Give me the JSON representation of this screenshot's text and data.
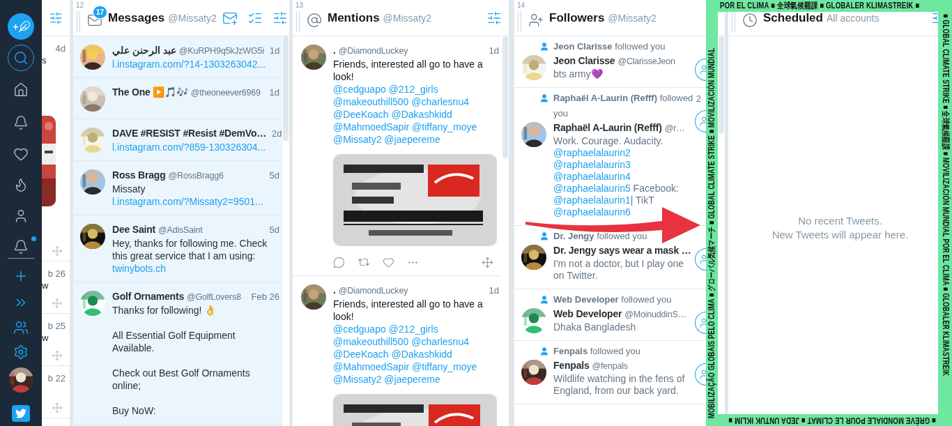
{
  "sidebar": {
    "items": [
      {
        "kind": "compose",
        "selected": false,
        "unread": false
      },
      {
        "kind": "search",
        "selected": false,
        "unread": false
      },
      {
        "kind": "home",
        "selected": false,
        "unread": false
      },
      {
        "kind": "notifications",
        "selected": false,
        "unread": false
      },
      {
        "kind": "likes",
        "selected": false,
        "unread": false
      },
      {
        "kind": "trending",
        "selected": false,
        "unread": false
      },
      {
        "kind": "profile",
        "selected": false,
        "unread": false
      },
      {
        "kind": "activity",
        "selected": true,
        "unread": true
      },
      {
        "kind": "add",
        "selected": false,
        "unread": false
      },
      {
        "kind": "expand",
        "selected": false,
        "unread": false
      },
      {
        "kind": "accounts",
        "selected": false,
        "unread": false
      },
      {
        "kind": "settings",
        "selected": false,
        "unread": false
      }
    ]
  },
  "partial_column": {
    "items": [
      {
        "time": "4d",
        "text": "s",
        "media": {
          "kind": "picture"
        }
      },
      {
        "time": "b 26",
        "text": "w"
      },
      {
        "time": "b 25",
        "text": "w"
      },
      {
        "time": "b 22"
      }
    ]
  },
  "columns": [
    {
      "kind": "messages",
      "number": "12",
      "title": "Messages",
      "subtitle": "@Missaty2",
      "badge": "17",
      "items": [
        {
          "name": "عبد الرحنن علي",
          "handle": "@KuRPH9q5kJzWG5i",
          "time": "1d",
          "body": [
            {
              "kind": "link",
              "text": "l.instagram.com/?14-1303263042..."
            }
          ]
        },
        {
          "name": "The One ▶️🎵🎶",
          "handle": "@theoneever6969",
          "time": "1d"
        },
        {
          "name": "DAVE #RESIST #Resist #DemVo…",
          "time": "2d",
          "body": [
            {
              "kind": "link",
              "text": "l.instagram.com/?859-130326304..."
            }
          ]
        },
        {
          "name": "Ross Bragg",
          "handle": "@RossBragg6",
          "time": "5d",
          "body": [
            {
              "kind": "text",
              "text": "Missaty "
            },
            {
              "kind": "link",
              "text": "l.instagram.com/?Missaty2=9501..."
            }
          ]
        },
        {
          "name": "Dee Saint",
          "handle": "@AdisSaint",
          "time": "5d",
          "body": [
            {
              "kind": "text",
              "text": "Hey, thanks for following me. Check this great service that I am using: "
            },
            {
              "kind": "link",
              "text": "twinybots.ch"
            }
          ]
        },
        {
          "name": "Golf Ornaments",
          "handle": "@GolfLovers8",
          "time": "Feb 26",
          "body": [
            {
              "kind": "text",
              "text": "Thanks for following! 👌\n\nAll Essential Golf Equipment Available.\n\nCheck out Best Golf Ornaments online;\n\nBuy NoW:"
            }
          ]
        }
      ]
    },
    {
      "kind": "mentions",
      "number": "13",
      "title": "Mentions",
      "subtitle": "@Missaty2",
      "items": [
        {
          "name": ".",
          "handle": "@DiamondLuckey",
          "time": "1d",
          "body": [
            {
              "kind": "text",
              "text": "Friends, interested all go to have a look!\n"
            },
            {
              "kind": "link",
              "text": "@cedguapo"
            },
            {
              "kind": "link",
              "text": "@212_girls"
            },
            {
              "kind": "link",
              "text": "@makeouthill500"
            },
            {
              "kind": "link",
              "text": "@charlesnu4"
            },
            {
              "kind": "link",
              "text": "@DeeKoach"
            },
            {
              "kind": "link",
              "text": "@Dakashkidd"
            },
            {
              "kind": "link",
              "text": "@MahmoedSapir"
            },
            {
              "kind": "link",
              "text": "@tiffany_moye"
            },
            {
              "kind": "link",
              "text": "@Missaty2"
            },
            {
              "kind": "link",
              "text": "@jaepereme"
            }
          ],
          "media": {
            "kind": "picture"
          },
          "actions": true
        },
        {
          "name": ".",
          "handle": "@DiamondLuckey",
          "time": "1d",
          "body": [
            {
              "kind": "text",
              "text": "Friends, interested all go to have a look!\n"
            },
            {
              "kind": "link",
              "text": "@cedguapo"
            },
            {
              "kind": "link",
              "text": "@212_girls"
            },
            {
              "kind": "link",
              "text": "@makeouthill500"
            },
            {
              "kind": "link",
              "text": "@charlesnu4"
            },
            {
              "kind": "link",
              "text": "@DeeKoach"
            },
            {
              "kind": "link",
              "text": "@Dakashkidd"
            },
            {
              "kind": "link",
              "text": "@MahmoedSapir"
            },
            {
              "kind": "link",
              "text": "@tiffany_moye"
            },
            {
              "kind": "link",
              "text": "@Missaty2"
            },
            {
              "kind": "link",
              "text": "@jaepereme"
            }
          ],
          "media": {
            "kind": "picture"
          },
          "actions": false
        }
      ]
    },
    {
      "kind": "followers",
      "number": "14",
      "title": "Followers",
      "subtitle": "@Missaty2",
      "items": [
        {
          "notice": "**Jeon Clarisse** followed you",
          "name": "Jeon Clarisse",
          "handle": "@ClarisseJeon",
          "body": [
            {
              "kind": "text",
              "text": "bts army💜"
            }
          ]
        },
        {
          "notice": "**Raphaël A-Laurin (Refff)** followed you",
          "time": "2",
          "name": "Raphaël A-Laurin (Refff)",
          "handle": "@r…",
          "body": [
            {
              "kind": "text",
              "text": "Work. Courage. Audacity.\n"
            },
            {
              "kind": "link",
              "text": "@raphaelalaurin2"
            },
            {
              "kind": "link",
              "text": "@raphaelalaurin3"
            },
            {
              "kind": "link",
              "text": "@raphaelalaurin4"
            },
            {
              "kind": "link",
              "text": "@raphaelalaurin5"
            },
            {
              "kind": "text",
              "text": " Facebook: "
            },
            {
              "kind": "link",
              "text": "@raphaelalaurin1"
            },
            {
              "kind": "text",
              "text": "| TikT "
            },
            {
              "kind": "link",
              "text": "@raphaelalaurin6"
            }
          ]
        },
        {
          "notice": "**Dr. Jengy** followed you",
          "name": "Dr. Jengy says wear a mask …",
          "body": [
            {
              "kind": "text",
              "text": "I'm not a doctor, but I play one on Twitter."
            }
          ]
        },
        {
          "notice": "**Web Developer** followed you",
          "name": "Web Developer",
          "handle": "@MoinuddinS…",
          "body": [
            {
              "kind": "text",
              "text": "Dhaka Bangladesh"
            }
          ]
        },
        {
          "notice": "**Fenpals** followed you",
          "name": "Fenpals",
          "handle": "@fenpals",
          "body": [
            {
              "kind": "text",
              "text": "Wildlife watching in the fens of England, from our back yard."
            }
          ]
        }
      ]
    },
    {
      "kind": "scheduled",
      "title": "Scheduled",
      "subtitle": "All accounts",
      "empty": "No recent Tweets.\nNew Tweets will appear here."
    }
  ],
  "climate_banner": {
    "top": "POR EL CLIMA ■ 全球氣候罷課 ■ GLOBALER KLIMASTREIK ■",
    "right": "■ GLOBAL CLIMATE STRIKE ■ 全球氣候罷課 ■ MOVILIZACIÓN MUNDIAL POR EL CLIMA ■ GLOBALER KLIMASTREIK",
    "bottom": "■ GRÈVE MONDIALE POUR LE CLIMAT ■ JEDA UNTUK IKLIM ■",
    "left": "MOBILIZAÇÃO GLOBAIS PELO CLIMA ■ グローバル気候マーチ ■ GLOBAL CLIMATE STRIKE ■ MOVILIZACIÓN MUNDIAL"
  }
}
